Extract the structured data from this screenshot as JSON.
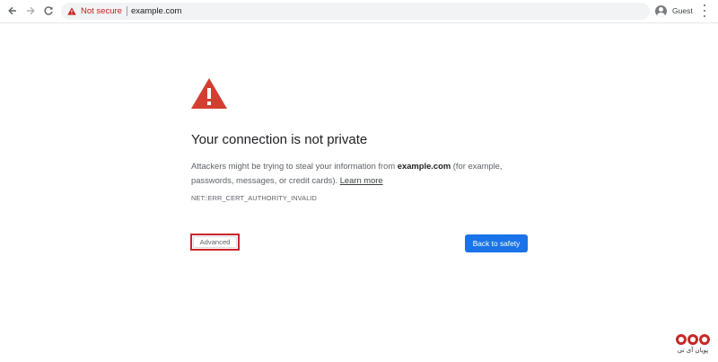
{
  "browser": {
    "security_label": "Not secure",
    "url": "example.com",
    "profile_name": "Guest"
  },
  "interstitial": {
    "heading": "Your connection is not private",
    "explanation_prefix": "Attackers might be trying to steal your information from ",
    "explanation_domain": "example.com",
    "explanation_suffix": " (for example, passwords, messages, or credit cards). ",
    "learn_more": "Learn more",
    "error_code": "NET::ERR_CERT_AUTHORITY_INVALID",
    "advanced_button": "Advanced",
    "back_button": "Back to safety"
  },
  "watermark": {
    "text": "پویان آی تی"
  },
  "colors": {
    "warning_red": "#d23f31",
    "not_secure_red": "#c5221f",
    "primary_blue": "#1a73e8",
    "highlight_red": "#c9262d"
  },
  "icons": {
    "back": "arrow-left-icon",
    "forward": "arrow-right-icon",
    "reload": "reload-icon",
    "security": "warning-triangle-icon",
    "profile": "person-icon",
    "menu": "more-vertical-icon",
    "main": "warning-triangle-icon"
  }
}
